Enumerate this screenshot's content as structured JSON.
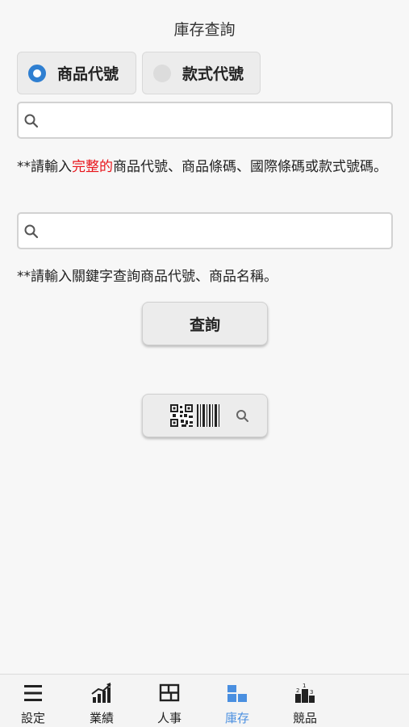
{
  "header": {
    "title": "庫存查詢"
  },
  "mode": {
    "options": [
      {
        "label": "商品代號",
        "selected": true
      },
      {
        "label": "款式代號",
        "selected": false
      }
    ]
  },
  "search1": {
    "value": "",
    "hint_prefix": "**請輸入",
    "hint_highlight": "完整的",
    "hint_suffix": "商品代號、商品條碼、國際條碼或款式號碼。"
  },
  "search2": {
    "value": "",
    "hint": "**請輸入關鍵字查詢商品代號、商品名稱。"
  },
  "query_button": {
    "label": "查詢"
  },
  "scan_button": {
    "icons": [
      "qr-code-icon",
      "barcode-icon",
      "search-icon"
    ]
  },
  "tabbar": {
    "tabs": [
      {
        "label": "設定",
        "icon": "menu-icon",
        "active": false
      },
      {
        "label": "業績",
        "icon": "chart-icon",
        "active": false
      },
      {
        "label": "人事",
        "icon": "grid-icon",
        "active": false
      },
      {
        "label": "庫存",
        "icon": "blocks-icon",
        "active": true
      },
      {
        "label": "競品",
        "icon": "podium-icon",
        "active": false
      }
    ]
  },
  "colors": {
    "accent": "#2f7fd1",
    "highlight": "#e8151b",
    "tab_active": "#4a8fe0"
  }
}
